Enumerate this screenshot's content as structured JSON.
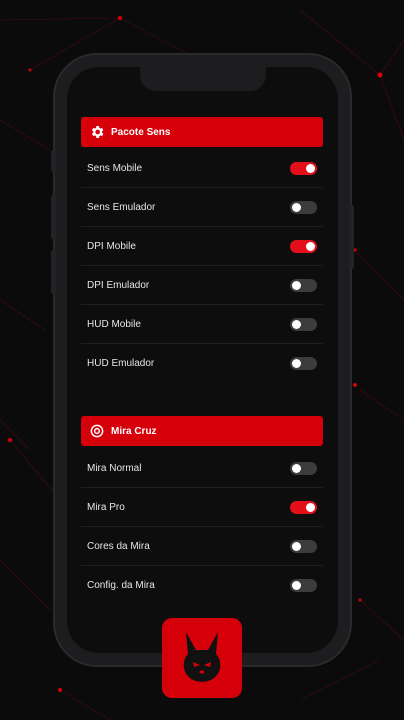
{
  "colors": {
    "accent": "#d6000a",
    "toggle_on": "#e3101c",
    "toggle_off": "#3c3c3e",
    "background": "#0b0b0c"
  },
  "sections": [
    {
      "title": "Pacote Sens",
      "icon": "gear-icon",
      "items": [
        {
          "label": "Sens Mobile",
          "on": true
        },
        {
          "label": "Sens Emulador",
          "on": false
        },
        {
          "label": "DPI Mobile",
          "on": true
        },
        {
          "label": "DPI Emulador",
          "on": false
        },
        {
          "label": "HUD Mobile",
          "on": false
        },
        {
          "label": "HUD Emulador",
          "on": false
        }
      ]
    },
    {
      "title": "Mira Cruz",
      "icon": "target-icon",
      "items": [
        {
          "label": "Mira Normal",
          "on": false
        },
        {
          "label": "Mira Pro",
          "on": true
        },
        {
          "label": "Cores da Mira",
          "on": false
        },
        {
          "label": "Config. da Mira",
          "on": false
        }
      ]
    }
  ],
  "app_icon": "rabbit-logo-icon"
}
